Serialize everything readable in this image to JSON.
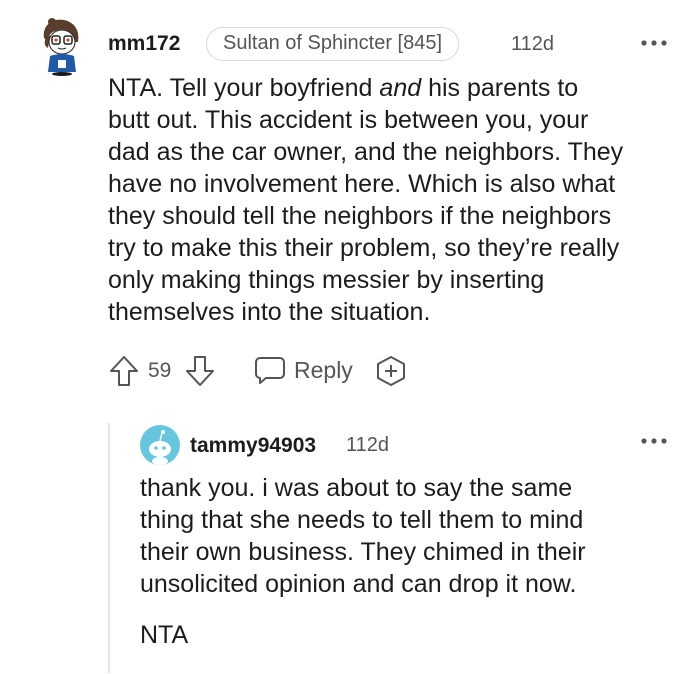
{
  "comment": {
    "username": "mm172",
    "flair": "Sultan of Sphincter [845]",
    "time": "112d",
    "body_html_parts": {
      "before": "NTA. Tell your boyfriend ",
      "emph": "and",
      "after": " his parents to\nbutt out. This accident is between you, your\ndad as the car owner, and the neighbors. They\nhave no involvement here. Which is also what\nthey should tell the neighbors if the neighbors\ntry to make this their problem, so they’re really\nonly making things messier by inserting\nthemselves into the situation."
    },
    "vote_count": "59",
    "reply_label": "Reply"
  },
  "reply": {
    "username": "tammy94903",
    "time": "112d",
    "body_paragraph_1": "thank you. i was about to say the same\nthing that she needs to tell them to mind\ntheir own business. They chimed in their\nunsolicited opinion and can drop it now.",
    "body_paragraph_2": "NTA"
  },
  "icons": {
    "upvote": "arrow-up-outline-icon",
    "downvote": "arrow-down-outline-icon",
    "reply": "speech-bubble-icon",
    "award": "award-plus-icon",
    "more": "ellipsis-icon"
  },
  "colors": {
    "text": "#1c1c1c",
    "meta": "#555555",
    "border": "#d8d8d8",
    "reply_avatar": "#66c6dd"
  }
}
